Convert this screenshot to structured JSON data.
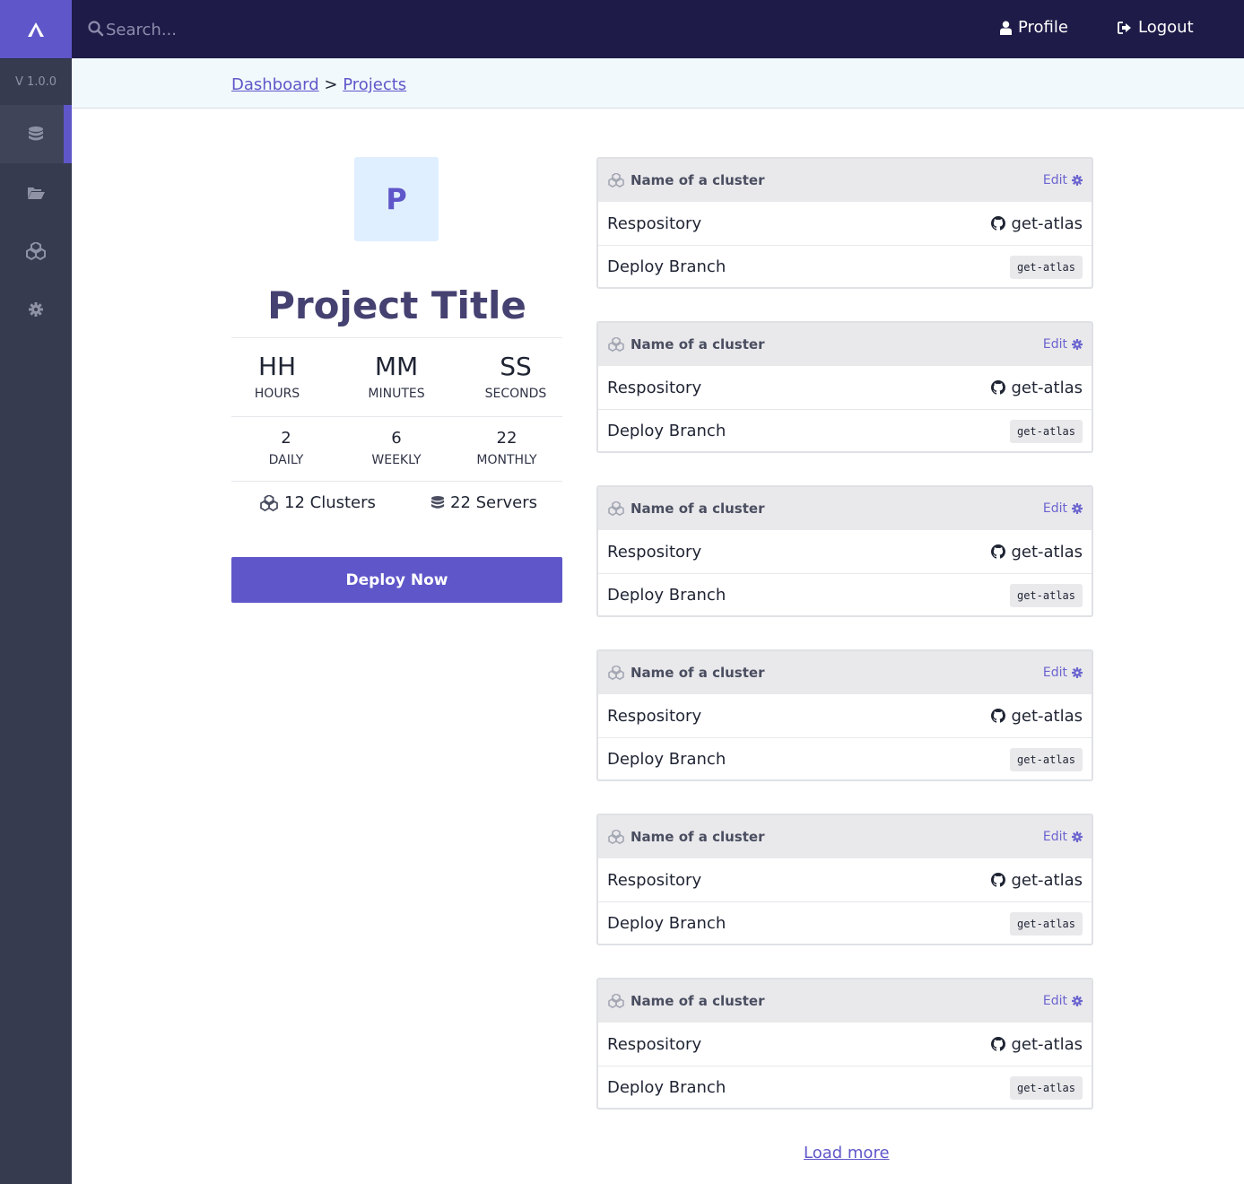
{
  "sidebar": {
    "version": "V 1.0.0",
    "items": [
      {
        "icon": "database-icon",
        "active": true
      },
      {
        "icon": "folder-open-icon",
        "active": false
      },
      {
        "icon": "cubes-icon",
        "active": false
      },
      {
        "icon": "gear-icon",
        "active": false
      }
    ]
  },
  "topbar": {
    "search_placeholder": "Search...",
    "profile_label": "Profile",
    "logout_label": "Logout"
  },
  "breadcrumb": {
    "items": [
      "Dashboard",
      "Projects"
    ],
    "separator": ">"
  },
  "project": {
    "avatar_letter": "P",
    "title": "Project Title",
    "time": [
      {
        "value": "HH",
        "label": "HOURS"
      },
      {
        "value": "MM",
        "label": "MINUTES"
      },
      {
        "value": "SS",
        "label": "SECONDS"
      }
    ],
    "frequency": [
      {
        "value": "2",
        "label": "DAILY"
      },
      {
        "value": "6",
        "label": "WEEKLY"
      },
      {
        "value": "22",
        "label": "MONTHLY"
      }
    ],
    "clusters_label": "12 Clusters",
    "servers_label": "22 Servers",
    "deploy_button": "Deploy Now"
  },
  "clusters": [
    {
      "name": "Name of a cluster",
      "edit": "Edit",
      "repo_label": "Respository",
      "repo": "get-atlas",
      "branch_label": "Deploy Branch",
      "branch": "get-atlas"
    },
    {
      "name": "Name of a cluster",
      "edit": "Edit",
      "repo_label": "Respository",
      "repo": "get-atlas",
      "branch_label": "Deploy Branch",
      "branch": "get-atlas"
    },
    {
      "name": "Name of a cluster",
      "edit": "Edit",
      "repo_label": "Respository",
      "repo": "get-atlas",
      "branch_label": "Deploy Branch",
      "branch": "get-atlas"
    },
    {
      "name": "Name of a cluster",
      "edit": "Edit",
      "repo_label": "Respository",
      "repo": "get-atlas",
      "branch_label": "Deploy Branch",
      "branch": "get-atlas"
    },
    {
      "name": "Name of a cluster",
      "edit": "Edit",
      "repo_label": "Respository",
      "repo": "get-atlas",
      "branch_label": "Deploy Branch",
      "branch": "get-atlas"
    },
    {
      "name": "Name of a cluster",
      "edit": "Edit",
      "repo_label": "Respository",
      "repo": "get-atlas",
      "branch_label": "Deploy Branch",
      "branch": "get-atlas"
    }
  ],
  "load_more": "Load more",
  "colors": {
    "accent": "#5f57c9",
    "topbar": "#1e1b48",
    "sidebar": "#363b4f"
  }
}
